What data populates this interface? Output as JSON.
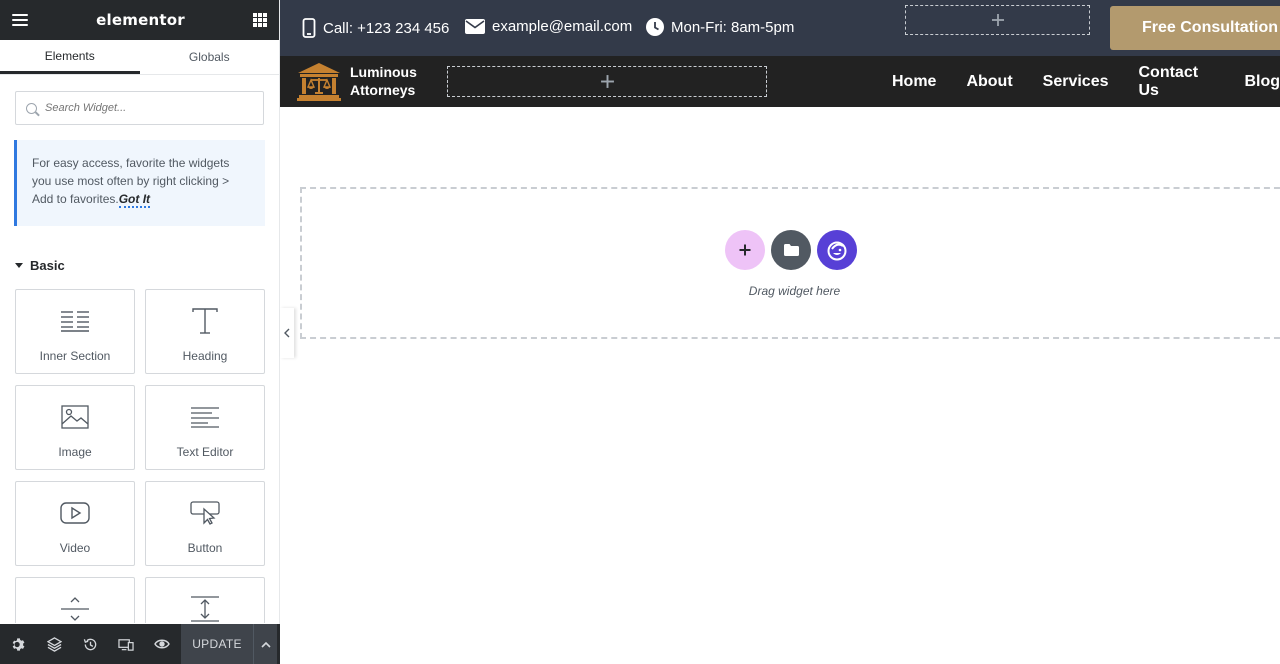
{
  "panel": {
    "brand": "elementor",
    "tabs": [
      {
        "label": "Elements",
        "active": true
      },
      {
        "label": "Globals",
        "active": false
      }
    ],
    "search_placeholder": "Search Widget...",
    "notice_text": "For easy access, favorite the widgets you use most often by right clicking > Add to favorites.",
    "notice_link": "Got It",
    "category": "Basic",
    "widgets": [
      {
        "label": "Inner Section",
        "icon": "inner-section-icon"
      },
      {
        "label": "Heading",
        "icon": "heading-icon"
      },
      {
        "label": "Image",
        "icon": "image-icon"
      },
      {
        "label": "Text Editor",
        "icon": "text-editor-icon"
      },
      {
        "label": "Video",
        "icon": "video-icon"
      },
      {
        "label": "Button",
        "icon": "button-icon"
      },
      {
        "label": "",
        "icon": "divider-icon"
      },
      {
        "label": "",
        "icon": "spacer-icon"
      }
    ],
    "footer": {
      "update_label": "UPDATE"
    }
  },
  "preview": {
    "topbar": {
      "phone": "Call: +123 234 456",
      "email": "example@email.com",
      "hours": "Mon-Fri: 8am-5pm",
      "cta": "Free Consultation"
    },
    "logo": {
      "line1": "Luminous",
      "line2": "Attorneys"
    },
    "menu": [
      "Home",
      "About",
      "Services",
      "Contact Us",
      "Blog"
    ],
    "dropzone_text": "Drag widget here"
  },
  "colors": {
    "panel_dark": "#26292c",
    "topbar": "#333a49",
    "navbar": "#222222",
    "cta": "#b39a6e",
    "add_button": "#eec3f7",
    "ai_button": "#5740d6",
    "notice_accent": "#2f79e0"
  }
}
